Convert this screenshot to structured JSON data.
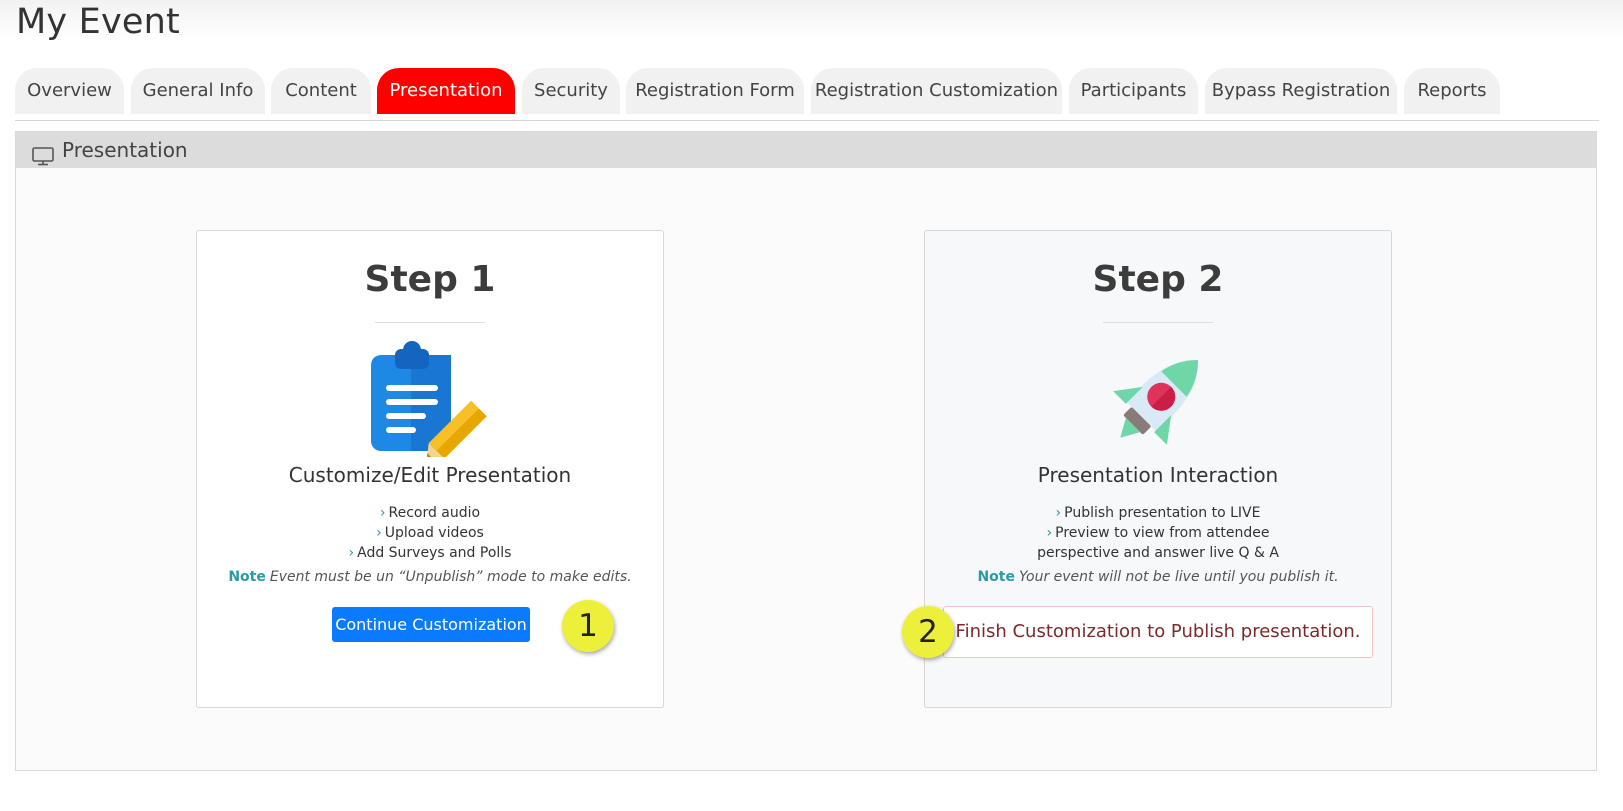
{
  "page": {
    "title": "My Event"
  },
  "tabs": [
    {
      "label": "Overview"
    },
    {
      "label": "General Info"
    },
    {
      "label": "Content"
    },
    {
      "label": "Presentation",
      "active": true
    },
    {
      "label": "Security"
    },
    {
      "label": "Registration Form"
    },
    {
      "label": "Registration Customization"
    },
    {
      "label": "Participants"
    },
    {
      "label": "Bypass Registration"
    },
    {
      "label": "Reports"
    }
  ],
  "panel": {
    "title": "Presentation",
    "icon": "monitor-icon"
  },
  "step1": {
    "title": "Step 1",
    "icon": "clipboard-edit-icon",
    "heading": "Customize/Edit Presentation",
    "features": [
      "Record audio",
      "Upload videos",
      "Add Surveys and Polls"
    ],
    "note_label": "Note",
    "note_text": "Event must be un “Unpublish” mode to make edits.",
    "button_label": "Continue Customization"
  },
  "step2": {
    "title": "Step 2",
    "icon": "rocket-icon",
    "heading": "Presentation Interaction",
    "features": [
      "Publish presentation to LIVE",
      "Preview to view from attendee",
      "perspective and answer live Q & A"
    ],
    "note_label": "Note",
    "note_text": "Your event will not be live until you publish it.",
    "alert_text": "Finish Customization to Publish presentation."
  },
  "markers": [
    "1",
    "2"
  ],
  "colors": {
    "active_tab": "#ff0000",
    "primary_button": "#0a7bff",
    "note_accent": "#2a9aa6",
    "marker": "#ecf03a",
    "alert_border": "#f2c4c8"
  }
}
